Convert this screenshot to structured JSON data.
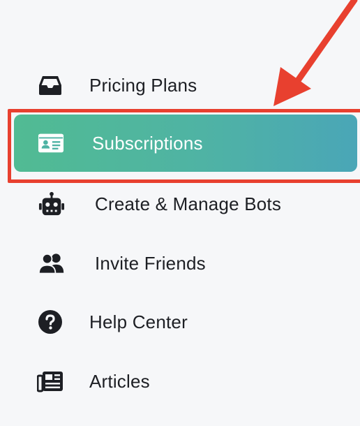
{
  "sidebar": {
    "items": [
      {
        "label": "Pricing Plans",
        "icon": "inbox-tray-icon"
      },
      {
        "label": "Subscriptions",
        "icon": "id-card-icon",
        "active": true
      },
      {
        "label": "Create & Manage Bots",
        "icon": "robot-icon"
      },
      {
        "label": "Invite Friends",
        "icon": "users-icon"
      },
      {
        "label": "Help Center",
        "icon": "question-circle-icon"
      },
      {
        "label": "Articles",
        "icon": "newspaper-icon"
      }
    ]
  },
  "colors": {
    "active_gradient_start": "#51bb93",
    "active_gradient_end": "#4aa6b7",
    "highlight": "#e8402f",
    "text": "#1d1f24",
    "background": "#f6f7f9"
  }
}
